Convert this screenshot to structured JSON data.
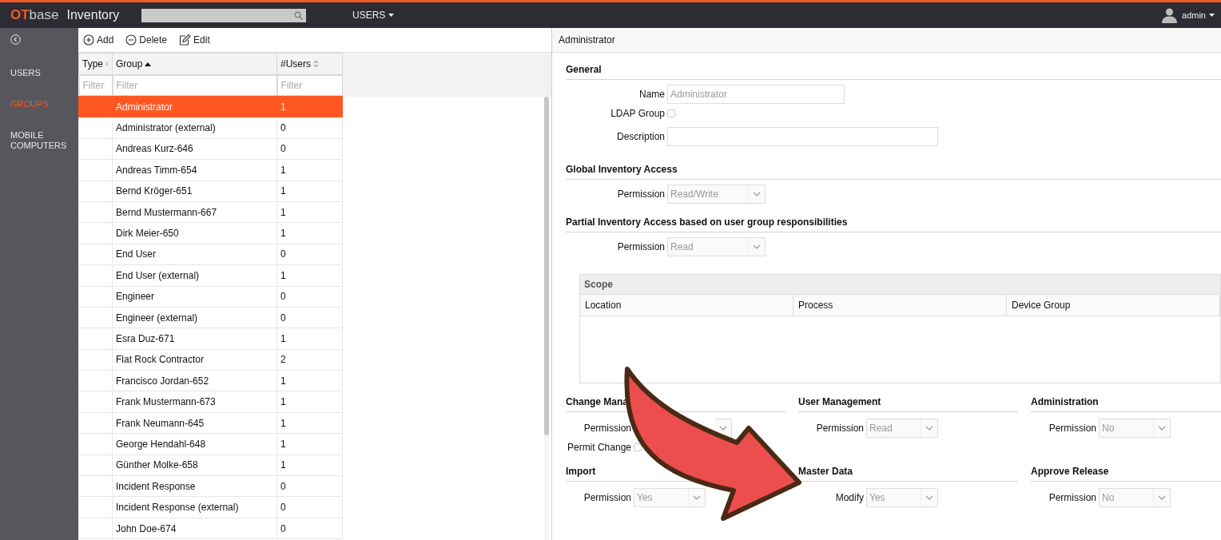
{
  "topbar": {
    "brand_strong": "OT",
    "brand_light": "base",
    "title": "Inventory",
    "nav_menu": "USERS",
    "user_menu": "admin"
  },
  "sidebar": {
    "items": [
      {
        "label": "USERS",
        "selected": false
      },
      {
        "label": "GROUPS",
        "selected": true
      },
      {
        "label": "MOBILE COMPUTERS",
        "selected": false
      }
    ]
  },
  "toolbar": [
    {
      "kind": "add",
      "label": "Add"
    },
    {
      "kind": "delete",
      "label": "Delete"
    },
    {
      "kind": "edit",
      "label": "Edit"
    }
  ],
  "table": {
    "columns": [
      {
        "label": "Type",
        "sorted": false,
        "filter_placeholder": "Filter"
      },
      {
        "label": "Group",
        "sorted": true,
        "filter_placeholder": "Filter"
      },
      {
        "label": "#Users",
        "sorted": false,
        "filter_placeholder": "Filter"
      }
    ],
    "rows": [
      {
        "group": "Administrator",
        "users": "1",
        "selected": true
      },
      {
        "group": "Administrator (external)",
        "users": "0",
        "selected": false
      },
      {
        "group": "Andreas Kurz-646",
        "users": "0",
        "selected": false
      },
      {
        "group": "Andreas Timm-654",
        "users": "1",
        "selected": false
      },
      {
        "group": "Bernd Kröger-651",
        "users": "1",
        "selected": false
      },
      {
        "group": "Bernd Mustermann-667",
        "users": "1",
        "selected": false
      },
      {
        "group": "Dirk Meier-650",
        "users": "1",
        "selected": false
      },
      {
        "group": "End User",
        "users": "0",
        "selected": false
      },
      {
        "group": "End User (external)",
        "users": "1",
        "selected": false
      },
      {
        "group": "Engineer",
        "users": "0",
        "selected": false
      },
      {
        "group": "Engineer (external)",
        "users": "0",
        "selected": false
      },
      {
        "group": "Esra Duz-671",
        "users": "1",
        "selected": false
      },
      {
        "group": "Flat Rock Contractor",
        "users": "2",
        "selected": false
      },
      {
        "group": "Francisco Jordan-652",
        "users": "1",
        "selected": false
      },
      {
        "group": "Frank Mustermann-673",
        "users": "1",
        "selected": false
      },
      {
        "group": "Frank Neumann-645",
        "users": "1",
        "selected": false
      },
      {
        "group": "George Hendahl-648",
        "users": "1",
        "selected": false
      },
      {
        "group": "Günther Molke-658",
        "users": "1",
        "selected": false
      },
      {
        "group": "Incident Response",
        "users": "0",
        "selected": false
      },
      {
        "group": "Incident Response (external)",
        "users": "0",
        "selected": false
      },
      {
        "group": "John Doe-674",
        "users": "0",
        "selected": false
      }
    ]
  },
  "detail": {
    "title": "Administrator",
    "sections": [
      {
        "heading": "General",
        "fields": [
          {
            "kind": "text",
            "label": "Name",
            "value": "Administrator"
          },
          {
            "kind": "checkbox",
            "label": "LDAP Group",
            "checked": false
          },
          {
            "kind": "wide-text",
            "label": "Description"
          }
        ]
      },
      {
        "heading": "Global Inventory Access",
        "fields": [
          {
            "kind": "select",
            "label": "Permission",
            "value": "Read/Write"
          }
        ]
      },
      {
        "heading": "Partial Inventory Access based on user group responsibilities",
        "fields": [
          {
            "kind": "select",
            "label": "Permission",
            "value": "Read"
          }
        ],
        "scope": {
          "title": "Scope",
          "columns": [
            "Location",
            "Process",
            "Device Group"
          ]
        }
      }
    ],
    "grid_sections": [
      {
        "heading": "Change Mana",
        "fields": [
          {
            "kind": "select",
            "label": "Permission"
          },
          {
            "kind": "checkbox",
            "label": "Permit Change",
            "checked": false
          }
        ]
      },
      {
        "heading": "User Management",
        "fields": [
          {
            "kind": "select",
            "label": "Permission",
            "value": "Read"
          }
        ]
      },
      {
        "heading": "Administration",
        "fields": [
          {
            "kind": "select",
            "label": "Permission",
            "value": "No"
          }
        ]
      },
      {
        "heading": "Import",
        "fields": [
          {
            "kind": "select",
            "label": "Permission",
            "value": "Yes"
          }
        ]
      },
      {
        "heading": "Master Data",
        "fields": [
          {
            "kind": "select",
            "label": "Modify",
            "value": "Yes"
          }
        ]
      },
      {
        "heading": "Approve Release",
        "fields": [
          {
            "kind": "select",
            "label": "Permission",
            "value": "No"
          }
        ]
      }
    ]
  },
  "annotation": {
    "kind": "curved-arrow"
  }
}
